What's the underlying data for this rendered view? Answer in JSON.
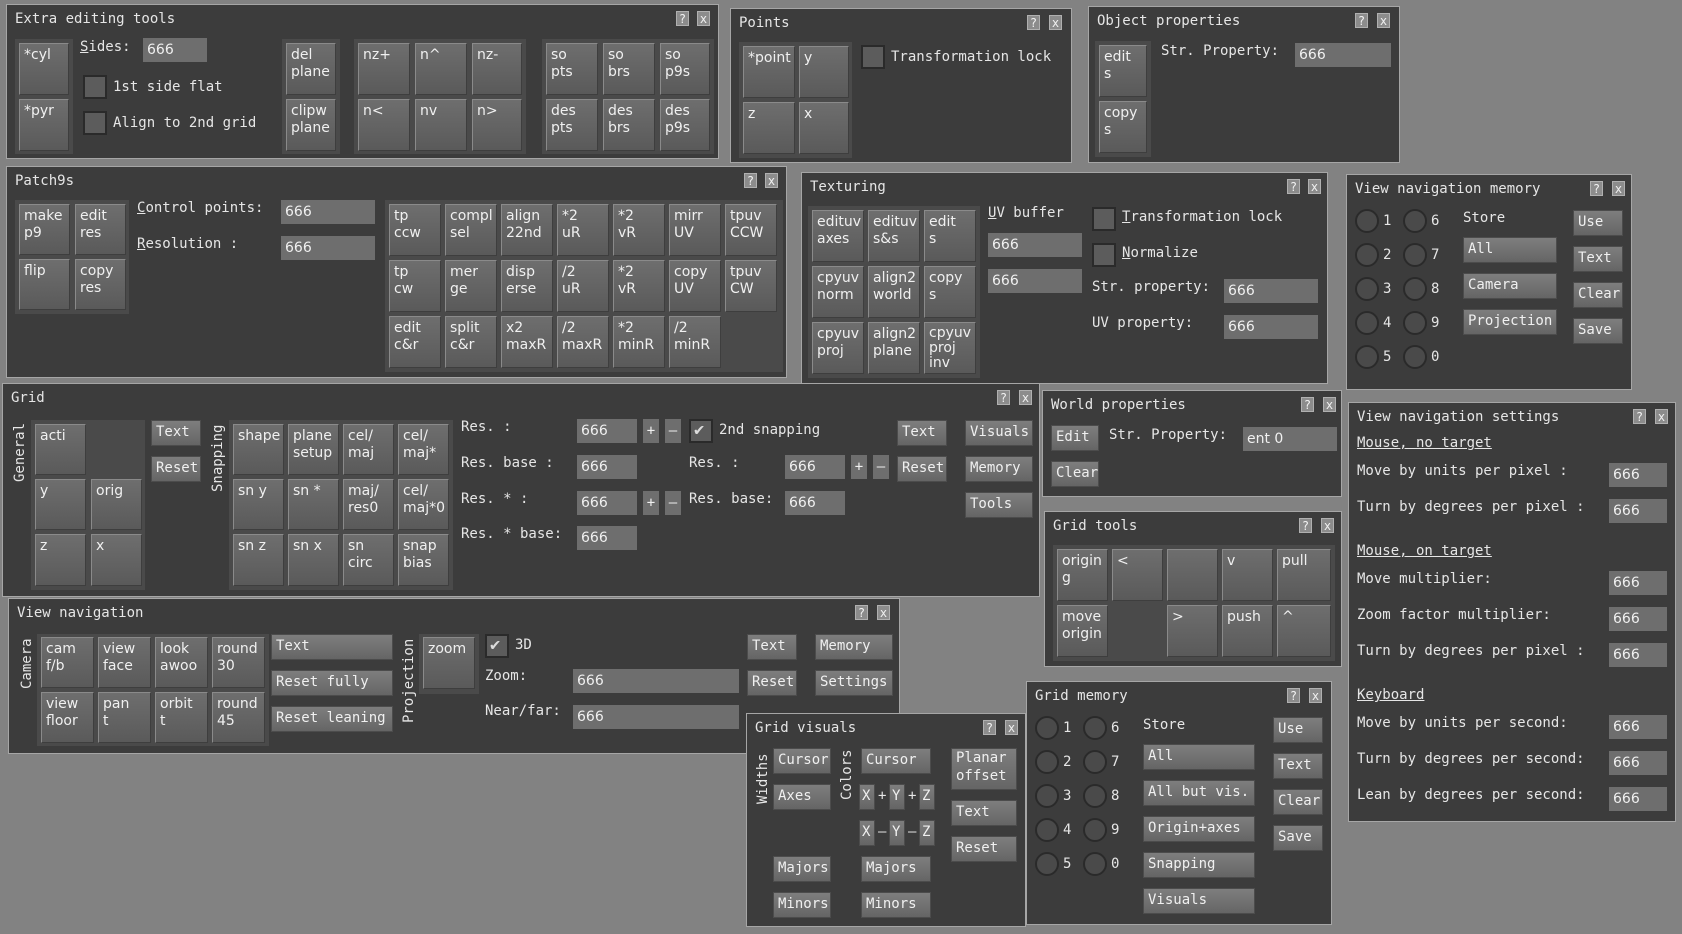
{
  "extra_tools": {
    "title": "Extra editing tools",
    "help": "?",
    "close": "x",
    "cyl": "*cyl",
    "pyr": "*pyr",
    "sides_label": "Sides:",
    "sides_value": "666",
    "first_side_flat": "1st side flat",
    "align_2nd_grid": "Align to 2nd grid",
    "del_plane": "del\nplane",
    "clipw_plane": "clipw\nplane",
    "nz_plus": "nz+",
    "n_up": "n^",
    "nz_minus": "nz-",
    "n_left": "n<",
    "nv": "nv",
    "n_right": "n>",
    "so_pts": "so\npts",
    "so_brs": "so\nbrs",
    "so_p9s": "so\np9s",
    "des_pts": "des\npts",
    "des_brs": "des\nbrs",
    "des_p9s": "des\np9s"
  },
  "points": {
    "title": "Points",
    "help": "?",
    "close": "x",
    "point": "*point",
    "y": "y",
    "z": "z",
    "x": "x",
    "transformation_lock": "Transformation lock"
  },
  "object_props": {
    "title": "Object properties",
    "help": "?",
    "close": "x",
    "edits": "edit\ns",
    "copys": "copy\ns",
    "str_property_label": "Str. Property:",
    "str_property_value": "666"
  },
  "patch9s": {
    "title": "Patch9s",
    "help": "?",
    "close": "x",
    "make_p9": "make\np9",
    "edit_res": "edit\nres",
    "flip": "flip",
    "copy_res": "copy\nres",
    "control_points_label": "Control points:",
    "control_points_value": "666",
    "resolution_label": "Resolution    :",
    "resolution_value": "666",
    "row1": [
      "tp\nccw",
      "compl\nsel",
      "align\n22nd",
      "*2\nuR",
      "*2\nvR",
      "mirr\nUV",
      "tpuv\nCCW"
    ],
    "row2": [
      "tp\ncw",
      "mer\nge",
      "disp\nerse",
      "/2\nuR",
      "*2\nvR",
      "copy\nUV",
      "tpuv\nCW"
    ],
    "row3": [
      "edit\nc&r",
      "split\nc&r",
      "x2\nmaxR",
      "/2\nmaxR",
      "*2\nminR",
      "/2\nminR"
    ]
  },
  "texturing": {
    "title": "Texturing",
    "help": "?",
    "close": "x",
    "edituv_axes": "edituv\naxes",
    "edituv_ss": "edituv\ns&s",
    "edits": "edit\ns",
    "cpyuv_norm": "cpyuv\nnorm",
    "align2_world": "align2\nworld",
    "copys": "copy\ns",
    "cpyuv_proj": "cpyuv\nproj",
    "align2_plane": "align2\nplane",
    "cpyuv_proj_inv": "cpyuv\nproj\ninv",
    "uv_buffer_label": "UV buffer",
    "uv_buffer_1": "666",
    "uv_buffer_2": "666",
    "transformation_lock": "Transformation lock",
    "normalize": "Normalize",
    "str_property_label": "Str. property:",
    "str_property_value": "666",
    "uv_property_label": "UV    property:",
    "uv_property_value": "666"
  },
  "view_nav_memory": {
    "title": "View navigation memory",
    "help": "?",
    "close": "x",
    "slots_left": [
      "1",
      "2",
      "3",
      "4",
      "5"
    ],
    "slots_right": [
      "6",
      "7",
      "8",
      "9",
      "0"
    ],
    "store_label": "Store",
    "store_buttons": [
      "All",
      "Camera",
      "Projection"
    ],
    "side_buttons": [
      "Use",
      "Text",
      "Clear",
      "Save"
    ]
  },
  "grid": {
    "title": "Grid",
    "help": "?",
    "close": "x",
    "general_label": "General",
    "snapping_label": "Snapping",
    "acti": "acti",
    "y": "y",
    "orig": "orig",
    "z": "z",
    "x": "x",
    "text": "Text",
    "reset": "Reset",
    "shape": "shape",
    "plane_setup": "plane\nsetup",
    "cel_maj": "cel/\nmaj",
    "cel_maj_star": "cel/\nmaj*",
    "sn_y": "sn y",
    "sn_star": "sn *",
    "maj_res0": "maj/\nres0",
    "cel_maj_star0": "cel/\nmaj*0",
    "sn_z": "sn z",
    "sn_x": "sn x",
    "sn_circ": "sn\ncirc",
    "snap_bias": "snap\nbias",
    "res_label": "Res.      :",
    "res_value": "666",
    "res_base_label": "Res. base  :",
    "res_base_value": "666",
    "res_star_label": "Res. *    :",
    "res_star_value": "666",
    "res_star_base_label": "Res. * base:",
    "res_star_base_value": "666",
    "plus": "+",
    "minus": "–",
    "second_snapping": "2nd snapping",
    "res2_label": "Res.      :",
    "res2_value": "666",
    "res2_base_label": "Res. base:",
    "res2_base_value": "666",
    "text2": "Text",
    "reset2": "Reset",
    "visuals": "Visuals",
    "memory": "Memory",
    "tools": "Tools"
  },
  "world_props": {
    "title": "World properties",
    "help": "?",
    "close": "x",
    "edit": "Edit",
    "clear": "Clear",
    "str_property_label": "Str. Property:",
    "str_property_value": "ent 0"
  },
  "grid_tools": {
    "title": "Grid tools",
    "help": "?",
    "close": "x",
    "origin_g": "origin\ng",
    "lt": "<",
    "v": "v",
    "pull": "pull",
    "move_origin": "move\norigin",
    "gt": ">",
    "push": "push",
    "caret": "^"
  },
  "view_nav_settings": {
    "title": "View navigation settings",
    "help": "?",
    "close": "x",
    "mouse_no_target": "Mouse, no target",
    "move_units_pixel": "Move by units    per pixel :",
    "move_units_pixel_value": "666",
    "turn_deg_pixel": "Turn by degrees per pixel :",
    "turn_deg_pixel_value": "666",
    "mouse_on_target": "Mouse, on target",
    "move_multiplier": "Move             multiplier:",
    "move_multiplier_value": "666",
    "zoom_multiplier": "Zoom factor      multiplier:",
    "zoom_multiplier_value": "666",
    "turn_deg_pixel2": "Turn by degrees per pixel :",
    "turn_deg_pixel2_value": "666",
    "keyboard": "Keyboard",
    "move_units_second": "Move by units    per second:",
    "move_units_second_value": "666",
    "turn_deg_second": "Turn by degrees per second:",
    "turn_deg_second_value": "666",
    "lean_deg_second": "Lean by degrees per second:",
    "lean_deg_second_value": "666"
  },
  "view_nav": {
    "title": "View navigation",
    "help": "?",
    "close": "x",
    "camera_label": "Camera",
    "projection_label": "Projection",
    "cam_fb": "cam\nf/b",
    "view_face": "view\nface",
    "look_awoo": "look\nawoo",
    "round30": "round\n30",
    "view_floor": "view\nfloor",
    "pan_t": "pan\nt",
    "orbit_t": "orbit\nt",
    "round45": "round\n45",
    "text": "Text",
    "reset_fully": "Reset fully",
    "reset_leaning": "Reset leaning",
    "zoom": "zoom",
    "three_d": "3D",
    "zoom_label": "Zoom:",
    "zoom_value": "666",
    "near_far_label": "Near/far:",
    "near_far_value": "666",
    "text2": "Text",
    "reset": "Reset",
    "memory": "Memory",
    "settings": "Settings"
  },
  "grid_visuals": {
    "title": "Grid visuals",
    "help": "?",
    "close": "x",
    "widths_label": "Widths",
    "colors_label": "Colors",
    "cursor": "Cursor",
    "axes": "Axes",
    "cursor2": "Cursor",
    "x": "X",
    "plus": "+",
    "y": "Y",
    "z": "Z",
    "minus": "–",
    "majors": "Majors",
    "minors": "Minors",
    "majors2": "Majors",
    "minors2": "Minors",
    "planar_offset": "Planar\noffset",
    "text": "Text",
    "reset": "Reset"
  },
  "grid_memory": {
    "title": "Grid memory",
    "help": "?",
    "close": "x",
    "slots_left": [
      "1",
      "2",
      "3",
      "4",
      "5"
    ],
    "slots_right": [
      "6",
      "7",
      "8",
      "9",
      "0"
    ],
    "store_label": "Store",
    "store_buttons": [
      "All",
      "All but vis.",
      "Origin+axes",
      "Snapping",
      "Visuals"
    ],
    "side_buttons": [
      "Use",
      "Text",
      "Clear",
      "Save"
    ]
  }
}
